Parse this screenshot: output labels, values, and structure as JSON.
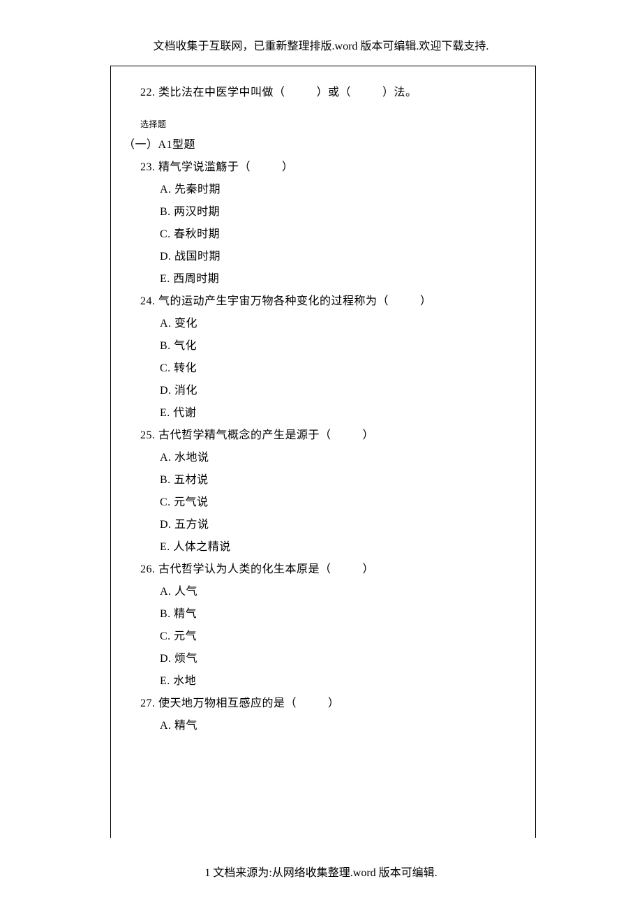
{
  "header_note": "文档收集于互联网，已重新整理排版.word 版本可编辑.欢迎下载支持.",
  "footer_note": "1 文档来源为:从网络收集整理.word 版本可编辑.",
  "q22_prefix": "22. 类比法在中医学中叫做（",
  "q22_mid": "）或（",
  "q22_suffix": "）法。",
  "small_heading": "选择题",
  "section_heading": "（一）A1型题",
  "questions": [
    {
      "stem_prefix": "23. 精气学说滥觞于（",
      "stem_suffix": "）",
      "options": [
        "A. 先秦时期",
        "B. 两汉时期",
        "C. 春秋时期",
        "D. 战国时期",
        "E. 西周时期"
      ]
    },
    {
      "stem_prefix": "24. 气的运动产生宇宙万物各种变化的过程称为（",
      "stem_suffix": "）",
      "options": [
        "A. 变化",
        "B. 气化",
        "C. 转化",
        "D. 消化",
        "E. 代谢"
      ]
    },
    {
      "stem_prefix": "25. 古代哲学精气概念的产生是源于（",
      "stem_suffix": "）",
      "options": [
        "A. 水地说",
        "B. 五材说",
        "C. 元气说",
        "D. 五方说",
        "E. 人体之精说"
      ]
    },
    {
      "stem_prefix": "26. 古代哲学认为人类的化生本原是（",
      "stem_suffix": "）",
      "options": [
        "A. 人气",
        "B. 精气",
        "C. 元气",
        "D. 烦气",
        "E. 水地"
      ]
    },
    {
      "stem_prefix": "27. 使天地万物相互感应的是（",
      "stem_suffix": "）",
      "options": [
        "A. 精气"
      ]
    }
  ]
}
